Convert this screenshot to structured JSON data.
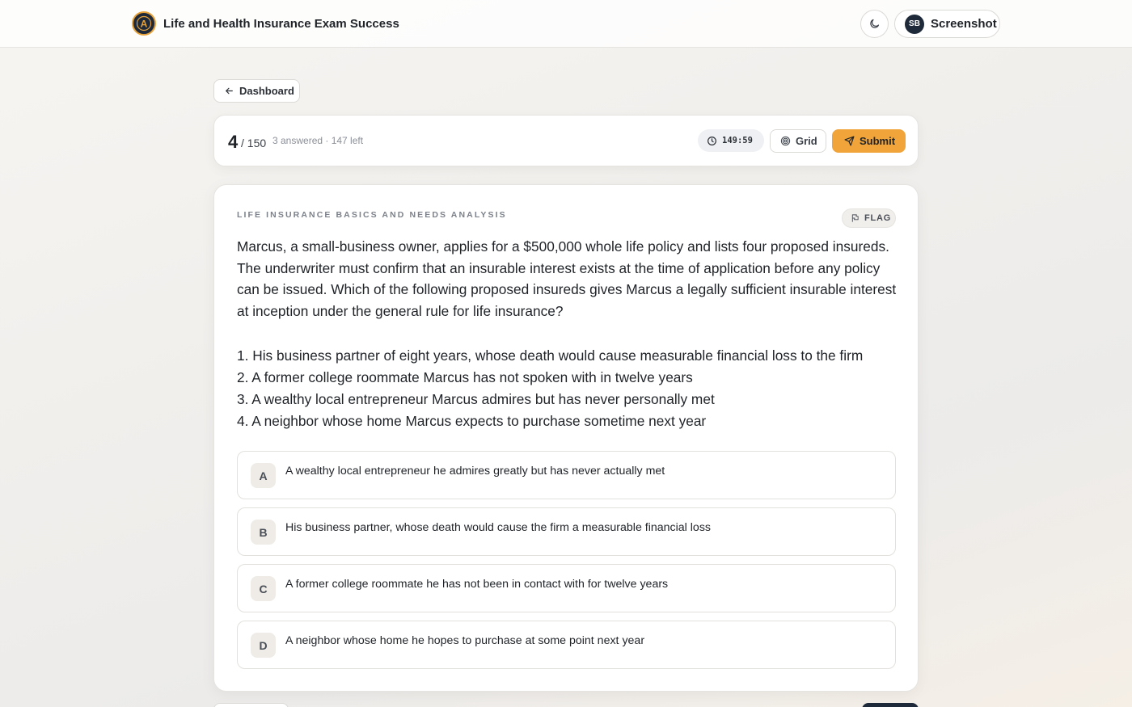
{
  "header": {
    "title": "Life and Health Insurance Exam Success",
    "logo_letter": "A",
    "user_initials": "SB",
    "user_name": "Screenshot"
  },
  "nav": {
    "dashboard_label": "Dashboard"
  },
  "status": {
    "current": "4",
    "total": "/ 150",
    "progress_text": "3 answered · 147 left",
    "timer": "149:59",
    "grid_label": "Grid",
    "submit_label": "Submit"
  },
  "question": {
    "category": "LIFE INSURANCE BASICS AND NEEDS ANALYSIS",
    "flag_label": "FLAG",
    "stem": "Marcus, a small-business owner, applies for a $500,000 whole life policy and lists four proposed insureds. The underwriter must confirm that an insurable interest exists at the time of application before any policy can be issued. Which of the following proposed insureds gives Marcus a legally sufficient insurable interest at inception under the general rule for life insurance?",
    "statements": [
      "1. His business partner of eight years, whose death would cause measurable financial loss to the firm",
      "2. A former college roommate Marcus has not spoken with in twelve years",
      "3. A wealthy local entrepreneur Marcus admires but has never personally met",
      "4. A neighbor whose home Marcus expects to purchase sometime next year"
    ],
    "options": [
      {
        "letter": "A",
        "text": "A wealthy local entrepreneur he admires greatly but has never actually met"
      },
      {
        "letter": "B",
        "text": "His business partner, whose death would cause the firm a measurable financial loss"
      },
      {
        "letter": "C",
        "text": "A former college roommate he has not been in contact with for twelve years"
      },
      {
        "letter": "D",
        "text": "A neighbor whose home he hopes to purchase at some point next year"
      }
    ]
  },
  "colors": {
    "accent": "#f0a43a",
    "navy": "#1e2a3a"
  }
}
